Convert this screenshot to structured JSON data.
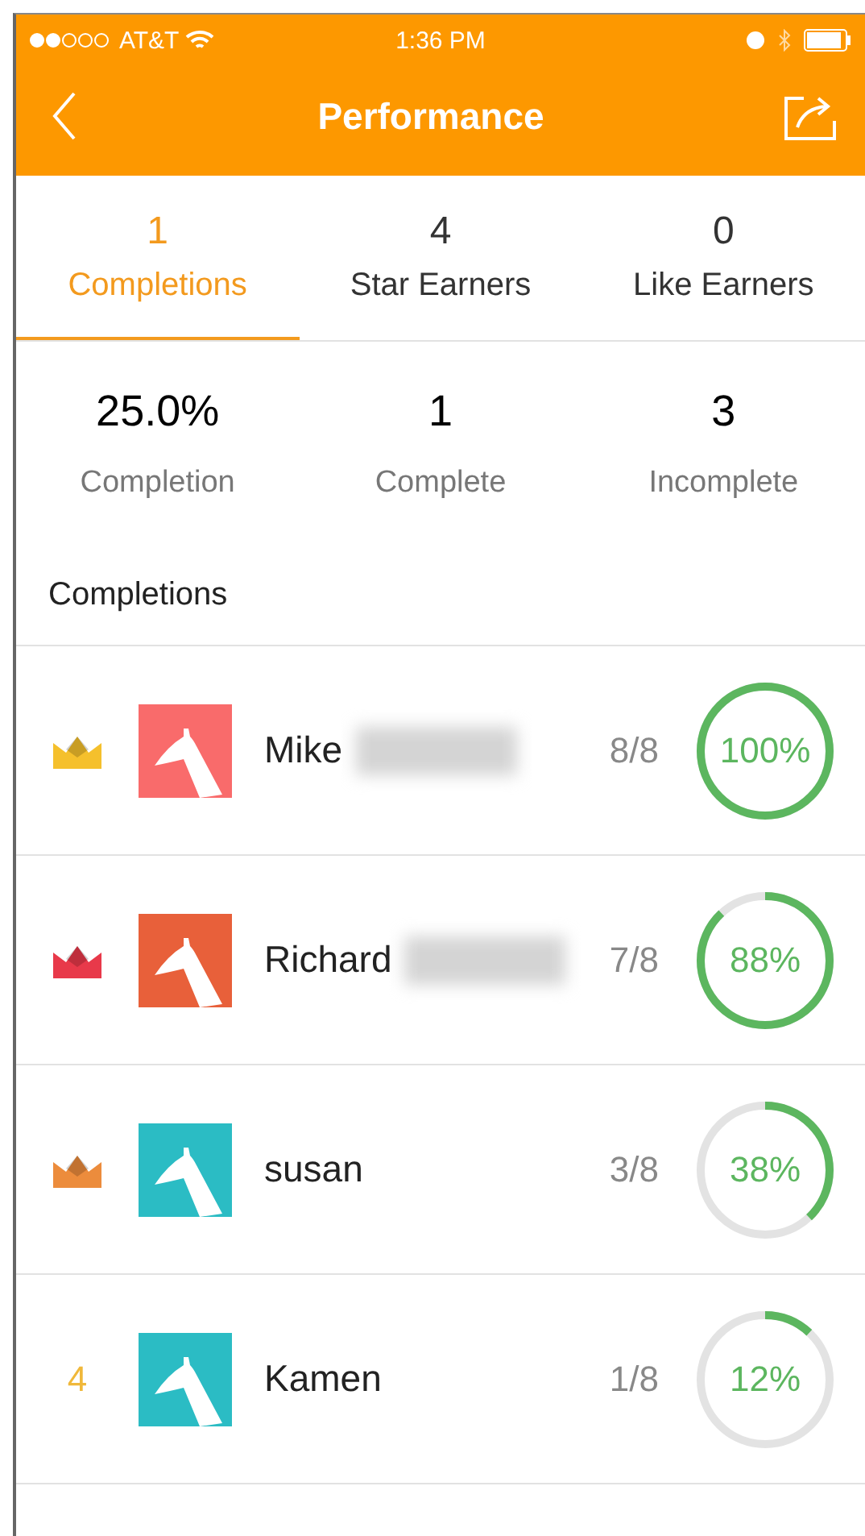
{
  "status_bar": {
    "carrier": "AT&T",
    "time": "1:36 PM"
  },
  "nav": {
    "title": "Performance"
  },
  "tabs": [
    {
      "count": "1",
      "label": "Completions",
      "selected": true
    },
    {
      "count": "4",
      "label": "Star Earners",
      "selected": false
    },
    {
      "count": "0",
      "label": "Like Earners",
      "selected": false
    }
  ],
  "stats": [
    {
      "value": "25.0%",
      "label": "Completion"
    },
    {
      "value": "1",
      "label": "Complete"
    },
    {
      "value": "3",
      "label": "Incomplete"
    }
  ],
  "section_title": "Completions",
  "rows": [
    {
      "rank": {
        "kind": "crown",
        "color": "#f5c02c"
      },
      "avatar": {
        "color": "#f96b6b"
      },
      "name": "Mike",
      "blurred": true,
      "score": "8/8",
      "level": 1.0,
      "percent": "100%"
    },
    {
      "rank": {
        "kind": "crown",
        "color": "#e8394a"
      },
      "avatar": {
        "color": "#e8603a"
      },
      "name": "Richard",
      "blurred": true,
      "score": "7/8",
      "level": 0.88,
      "percent": "88%"
    },
    {
      "rank": {
        "kind": "crown",
        "color": "#ec8c3c"
      },
      "avatar": {
        "color": "#2bbcc4"
      },
      "name": "susan",
      "blurred": false,
      "score": "3/8",
      "level": 0.38,
      "percent": "38%"
    },
    {
      "rank": {
        "kind": "number",
        "text": "4"
      },
      "avatar": {
        "color": "#2bbcc4"
      },
      "name": "Kamen",
      "blurred": false,
      "score": "1/8",
      "level": 0.12,
      "percent": "12%"
    }
  ]
}
